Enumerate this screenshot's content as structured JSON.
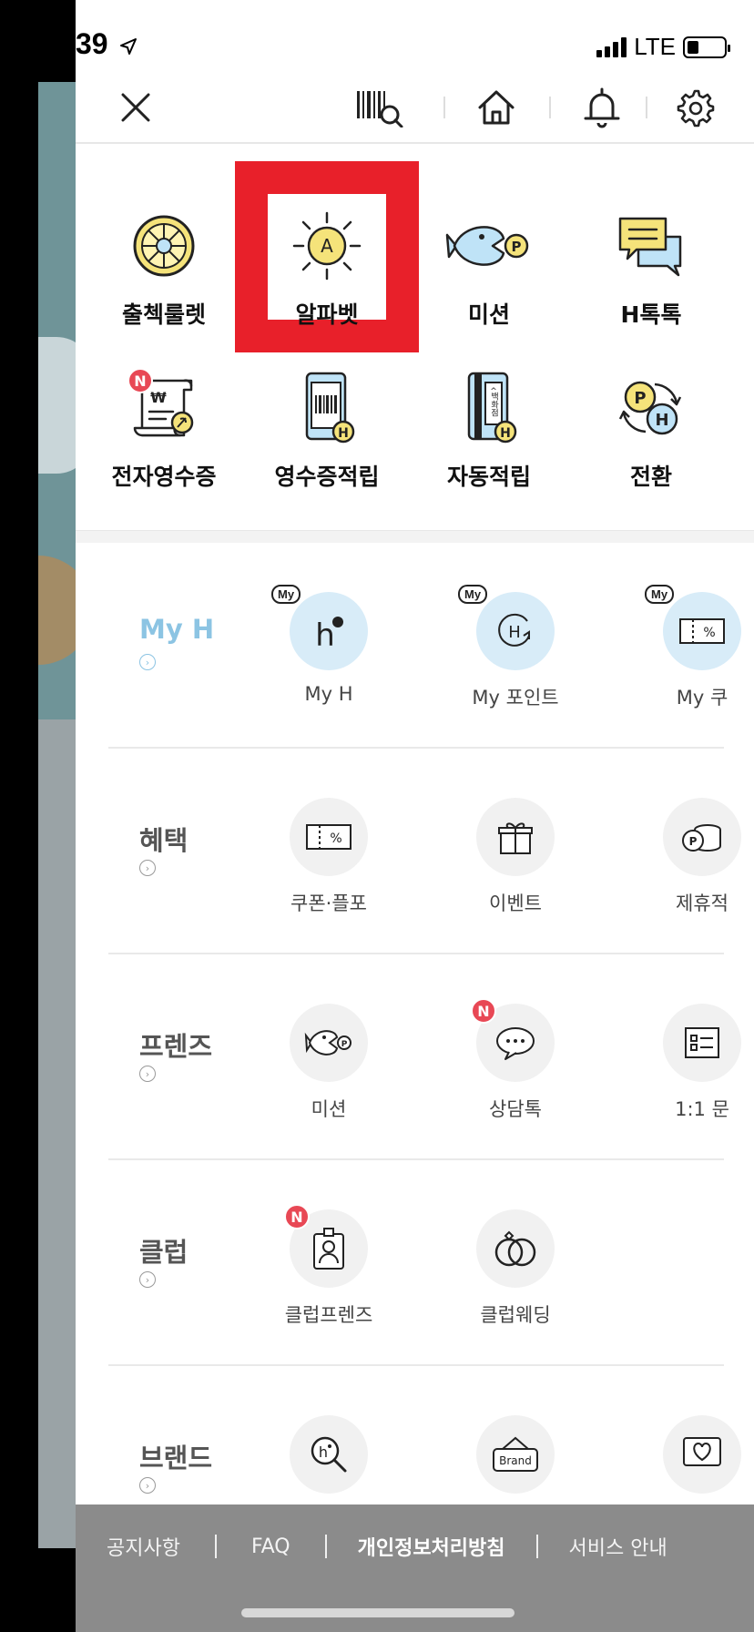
{
  "status": {
    "time": "39",
    "network": "LTE"
  },
  "topnav": {
    "icons": [
      "close-icon",
      "barcode-search-icon",
      "home-icon",
      "bell-icon",
      "gear-icon"
    ]
  },
  "quick_menu": [
    {
      "label": "출첵룰렛",
      "icon": "roulette-icon",
      "badge": null
    },
    {
      "label": "알파벳",
      "icon": "alphabet-sun-icon",
      "badge": null,
      "highlighted": true
    },
    {
      "label": "미션",
      "icon": "fish-point-icon",
      "badge": null
    },
    {
      "label": "H톡톡",
      "icon": "chat-bubbles-icon",
      "badge": null
    },
    {
      "label": "전자영수증",
      "icon": "e-receipt-icon",
      "badge": "N"
    },
    {
      "label": "영수증적립",
      "icon": "phone-barcode-icon",
      "badge": null
    },
    {
      "label": "자동적립",
      "icon": "card-icon",
      "badge": null
    },
    {
      "label": "전환",
      "icon": "point-convert-icon",
      "badge": null
    }
  ],
  "card_text": "백화점",
  "sections": [
    {
      "title": "My H",
      "active": true,
      "items": [
        {
          "label": "My H",
          "icon": "h-logo-icon",
          "tag": "My"
        },
        {
          "label": "My 포인트",
          "icon": "h-refresh-icon",
          "tag": "My"
        },
        {
          "label": "My 쿠",
          "icon": "coupon-icon",
          "tag": "My"
        }
      ]
    },
    {
      "title": "혜택",
      "active": false,
      "items": [
        {
          "label": "쿠폰·플포",
          "icon": "coupon-percent-icon"
        },
        {
          "label": "이벤트",
          "icon": "gift-icon"
        },
        {
          "label": "제휴적",
          "icon": "coins-icon"
        }
      ]
    },
    {
      "title": "프렌즈",
      "active": false,
      "items": [
        {
          "label": "미션",
          "icon": "fish-icon"
        },
        {
          "label": "상담톡",
          "icon": "speech-dots-icon",
          "badge": "N"
        },
        {
          "label": "1:1 문",
          "icon": "inquiry-icon"
        }
      ]
    },
    {
      "title": "클럽",
      "active": false,
      "items": [
        {
          "label": "클럽프렌즈",
          "icon": "id-badge-icon",
          "badge": "N"
        },
        {
          "label": "클럽웨딩",
          "icon": "rings-icon"
        }
      ]
    },
    {
      "title": "브랜드",
      "active": false,
      "items": [
        {
          "label": "",
          "icon": "h-magnifier-icon"
        },
        {
          "label": "",
          "icon": "brand-sign-icon",
          "sign_text": "Brand"
        },
        {
          "label": "",
          "icon": "heart-screen-icon"
        }
      ]
    }
  ],
  "footer": {
    "links": [
      "공지사항",
      "FAQ",
      "개인정보처리방침",
      "서비스 안내"
    ]
  },
  "colors": {
    "accent_red": "#e8202a",
    "myh_blue": "#8cc4e3",
    "badge_red": "#e84855",
    "footer_gray": "#8b8b8b",
    "icon_yellow": "#f5e37a",
    "icon_lightblue": "#bfe3f7"
  }
}
